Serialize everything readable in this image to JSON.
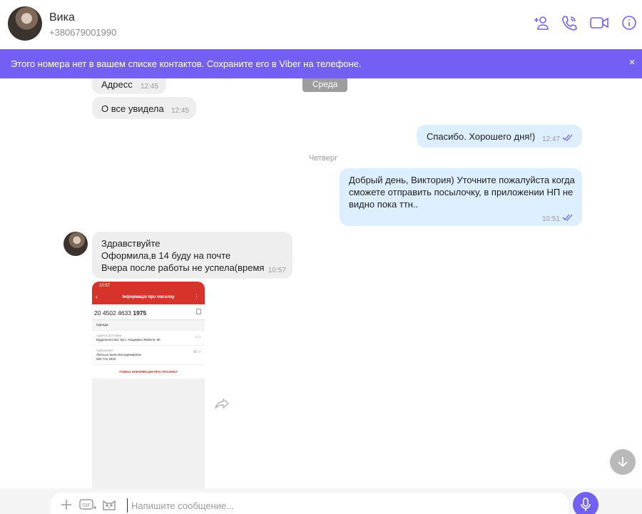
{
  "header": {
    "contact_name": "Вика",
    "contact_phone": "+380679001990",
    "icons": [
      "add-contact-icon",
      "phone-call-icon",
      "video-call-icon",
      "info-icon"
    ]
  },
  "banner": {
    "text": "Этого номера нет в вашем списке контактов. Сохраните его в Viber на телефоне.",
    "close": "×"
  },
  "messages": [
    {
      "dir": "in",
      "text": "Адресс",
      "time": "12:45"
    },
    {
      "dir": "in",
      "text": "О все увидела",
      "time": "12:45"
    },
    {
      "dir": "out",
      "text": "Спасибо. Хорошего дня!)",
      "time": "12:47"
    },
    {
      "dir": "out",
      "text": "Добрый день, Виктория) Уточните пожалуйста когда\nсможете отправить посылочку, в приложении НП не\nвидно пока ттн..",
      "time": "10:51"
    },
    {
      "dir": "in",
      "text": "Здравствуйте\nОформила,в 14 буду на почте\nВчера после работы не успела(время",
      "time": "10:57"
    }
  ],
  "day_separators": {
    "wednesday": "Среда",
    "thursday": "Четверг"
  },
  "screenshot": {
    "status_time": "10:57",
    "title": "Інформація про посилку",
    "number_prefix": "20 4502 4633 ",
    "number_bold": "1975",
    "category": "Одежда",
    "address_label": "Адреса доставки",
    "address_value": "Відділення №4: вул. Академіка Ямвеля, 86",
    "recipient_label": "Одержувач",
    "recipient_name": "Липська Ірина Володимирівна",
    "recipient_phone": "093 744 2822",
    "more_link": "ПОВНА ІНФОРМАЦІЯ ПРО ПОСИЛКУ"
  },
  "composer": {
    "placeholder": "Напишите сообщение..."
  },
  "colors": {
    "accent": "#7360f2",
    "outgoing_bubble": "#ddeeff",
    "incoming_bubble": "#eeeeee",
    "np_red": "#d6332a"
  }
}
